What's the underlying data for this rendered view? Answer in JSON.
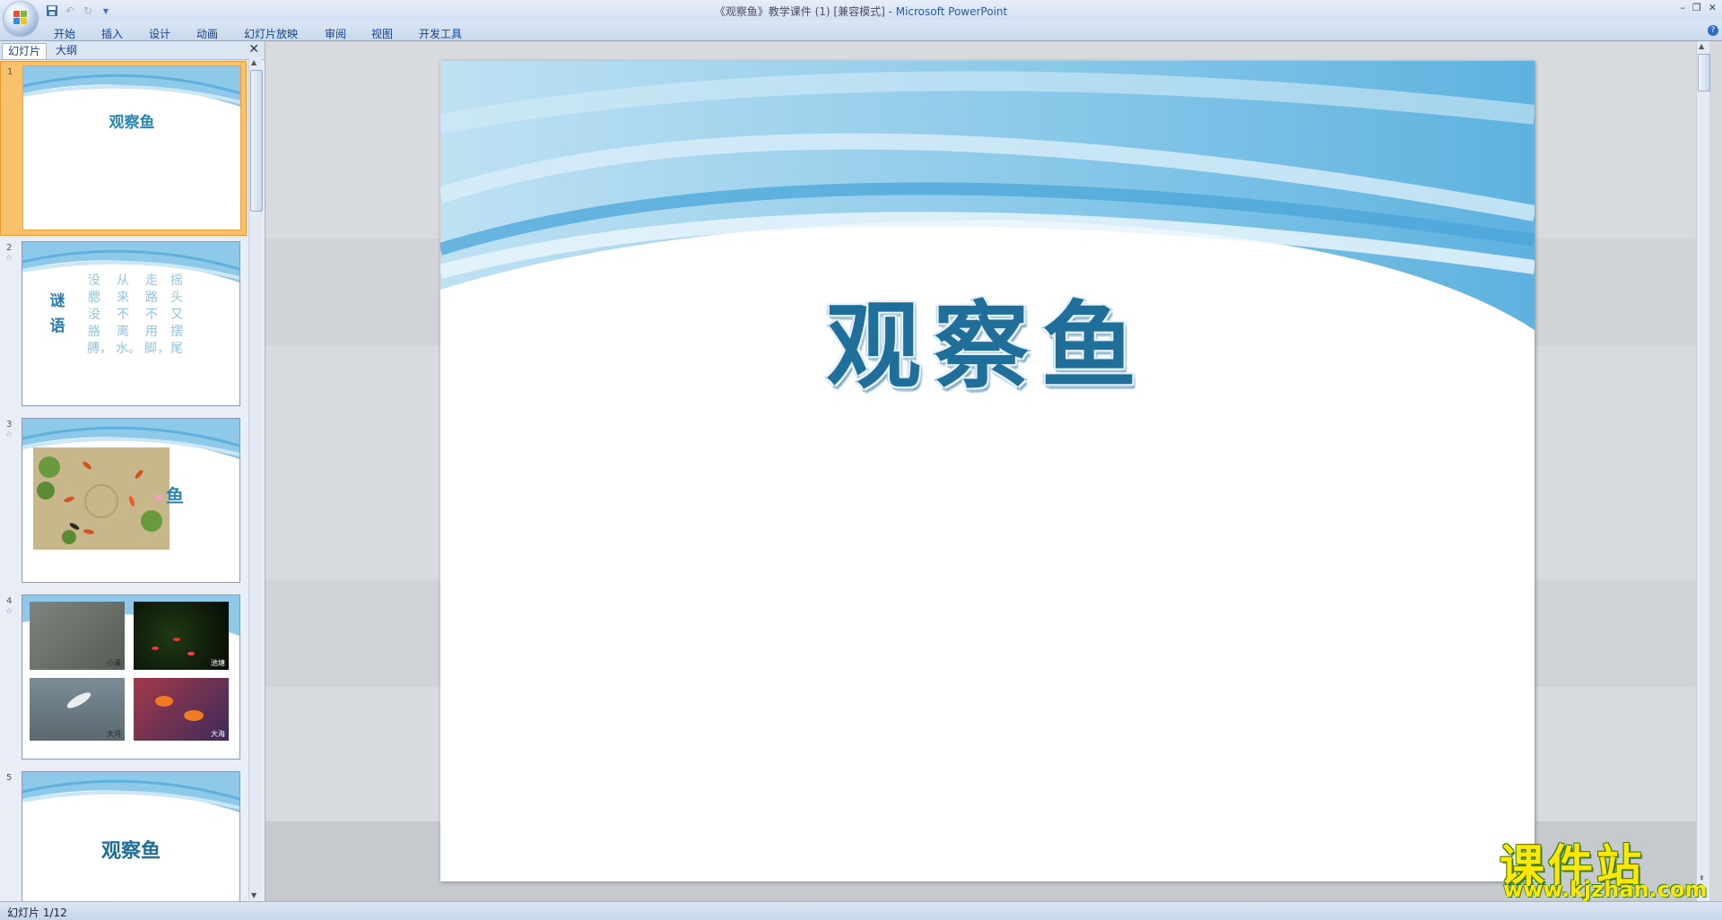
{
  "window": {
    "title": "《观察鱼》教学课件 (1) [兼容模式] - ",
    "app_name": "Microsoft PowerPoint",
    "controls": [
      "–",
      "❐",
      "✕"
    ]
  },
  "quick_access": {
    "save_icon": "save-icon",
    "undo_icon": "undo-icon",
    "redo_icon": "redo-icon"
  },
  "ribbon": {
    "tabs": [
      "开始",
      "插入",
      "设计",
      "动画",
      "幻灯片放映",
      "审阅",
      "视图",
      "开发工具"
    ],
    "help_label": "?"
  },
  "panel": {
    "tabs": [
      "幻灯片",
      "大纲"
    ],
    "close_label": "✕",
    "slides": [
      {
        "number": "1",
        "title": "观察鱼",
        "selected": true
      },
      {
        "number": "2",
        "title": "谜语",
        "star": "☆",
        "columns": [
          "没腮没胳膊，",
          "从来不离水。",
          "走路不用脚，",
          "摇头又摆尾"
        ]
      },
      {
        "number": "3",
        "title": "鱼",
        "star": "☆"
      },
      {
        "number": "4",
        "star": "☆",
        "captions": [
          "小溪",
          "池塘",
          "大河",
          "大海"
        ]
      },
      {
        "number": "5",
        "title": "观察鱼"
      }
    ]
  },
  "slide": {
    "title": "观察鱼"
  },
  "watermark": {
    "top": "课件站",
    "bottom": "www.kjzhan.com"
  },
  "status": {
    "slide_position": "幻灯片 1/12"
  },
  "colors": {
    "accent": "#1f6f9a",
    "selection": "#f9c26a",
    "wave": "#5fb0dc"
  }
}
